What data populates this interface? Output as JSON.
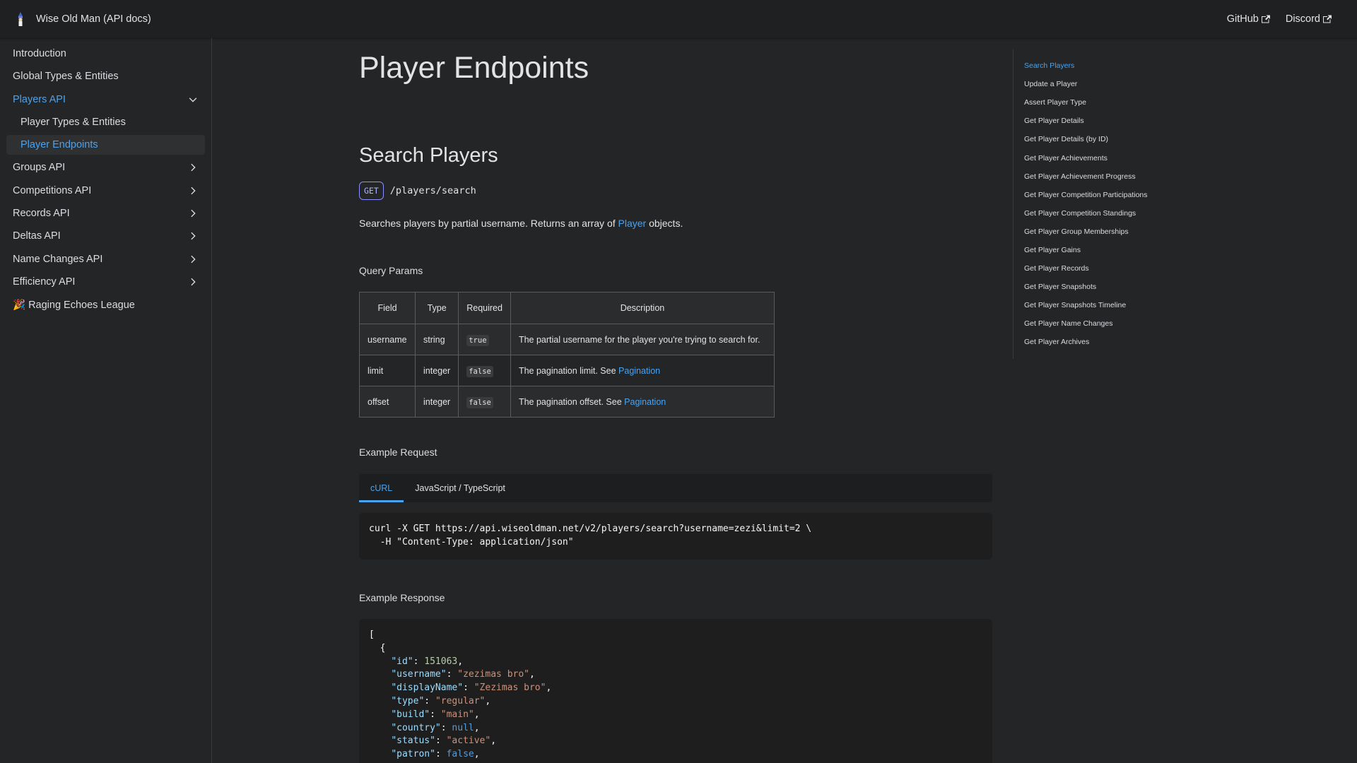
{
  "navbar": {
    "title": "Wise Old Man (API docs)",
    "links": [
      {
        "label": "GitHub"
      },
      {
        "label": "Discord"
      }
    ]
  },
  "sidebar": {
    "items": [
      {
        "label": "Introduction"
      },
      {
        "label": "Global Types & Entities"
      },
      {
        "label": "Players API"
      },
      {
        "label": "Player Types & Entities"
      },
      {
        "label": "Player Endpoints"
      },
      {
        "label": "Groups API"
      },
      {
        "label": "Competitions API"
      },
      {
        "label": "Records API"
      },
      {
        "label": "Deltas API"
      },
      {
        "label": "Name Changes API"
      },
      {
        "label": "Efficiency API"
      },
      {
        "label": "🎉 Raging Echoes League"
      }
    ]
  },
  "main": {
    "title": "Player Endpoints",
    "section_title": "Search Players",
    "method": "GET",
    "path": "/players/search",
    "desc_prefix": "Searches players by partial username. Returns an array of ",
    "desc_link": "Player",
    "desc_suffix": " objects.",
    "query_params_label": "Query Params",
    "table": {
      "headers": [
        "Field",
        "Type",
        "Required",
        "Description"
      ],
      "rows": [
        {
          "field": "username",
          "type": "string",
          "required": "true",
          "desc": "The partial username for the player you're trying to search for.",
          "link": ""
        },
        {
          "field": "limit",
          "type": "integer",
          "required": "false",
          "desc": "The pagination limit. See ",
          "link": "Pagination"
        },
        {
          "field": "offset",
          "type": "integer",
          "required": "false",
          "desc": "The pagination offset. See ",
          "link": "Pagination"
        }
      ]
    },
    "example_request_label": "Example Request",
    "tabs": [
      "cURL",
      "JavaScript / TypeScript"
    ],
    "request_code": [
      "curl -X GET https://api.wiseoldman.net/v2/players/search?username=zezi&limit=2 \\",
      "  -H \"Content-Type: application/json\""
    ],
    "example_response_label": "Example Response",
    "response": {
      "open_bracket": "[",
      "open_brace": "{",
      "id_key": "\"id\"",
      "id_val": "151063",
      "username_key": "\"username\"",
      "username_val": "\"zezimas bro\"",
      "displayName_key": "\"displayName\"",
      "displayName_val": "\"Zezimas bro\"",
      "type_key": "\"type\"",
      "type_val": "\"regular\"",
      "build_key": "\"build\"",
      "build_val": "\"main\"",
      "country_key": "\"country\"",
      "country_val": "null",
      "status_key": "\"status\"",
      "status_val": "\"active\"",
      "patron_key": "\"patron\"",
      "patron_val": "false"
    }
  },
  "toc": {
    "items": [
      "Search Players",
      "Update a Player",
      "Assert Player Type",
      "Get Player Details",
      "Get Player Details (by ID)",
      "Get Player Achievements",
      "Get Player Achievement Progress",
      "Get Player Competition Participations",
      "Get Player Competition Standings",
      "Get Player Group Memberships",
      "Get Player Gains",
      "Get Player Records",
      "Get Player Snapshots",
      "Get Player Snapshots Timeline",
      "Get Player Name Changes",
      "Get Player Archives"
    ]
  },
  "colors": {
    "accent": "#4aa3f0",
    "background": "#242526",
    "navbar": "#1f2021",
    "method_badge": "#8c8dff"
  }
}
